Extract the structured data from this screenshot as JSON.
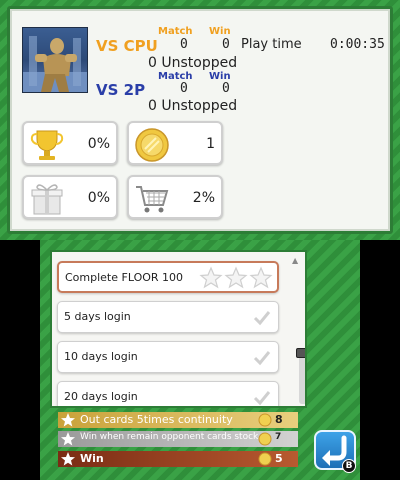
{
  "top": {
    "vs_cpu": {
      "label": "VS CPU",
      "match_header": "Match",
      "win_header": "Win",
      "match": "0",
      "win": "0",
      "unstopped": "0 Unstopped"
    },
    "vs_2p": {
      "label": "VS 2P",
      "match_header": "Match",
      "win_header": "Win",
      "match": "0",
      "win": "0",
      "unstopped": "0 Unstopped"
    },
    "play_time_label": "Play time",
    "play_time_value": "0:00:35",
    "stats": {
      "trophy": {
        "icon": "trophy-icon",
        "value": "0%"
      },
      "coin": {
        "icon": "coin-icon",
        "value": "1"
      },
      "gift": {
        "icon": "gift-icon",
        "value": "0%"
      },
      "cart": {
        "icon": "cart-icon",
        "value": "2%"
      }
    }
  },
  "bottom": {
    "list": [
      {
        "label": "Complete FLOOR 100",
        "selected": true
      },
      {
        "label": "5 days login"
      },
      {
        "label": "10 days login"
      },
      {
        "label": "20 days login"
      }
    ],
    "tiers": {
      "gold": {
        "text": "Out cards 5times continuity",
        "count": "8"
      },
      "silver": {
        "text": "Win when remain opponent cards stock",
        "count": "7"
      },
      "bronze": {
        "text": "Win",
        "count": "5"
      }
    },
    "back_badge": "B"
  },
  "colors": {
    "felt_green": "#3aa246",
    "accent_orange": "#f0a020",
    "accent_blue": "#2a3ea8",
    "back_blue": "#1d6fb6"
  }
}
